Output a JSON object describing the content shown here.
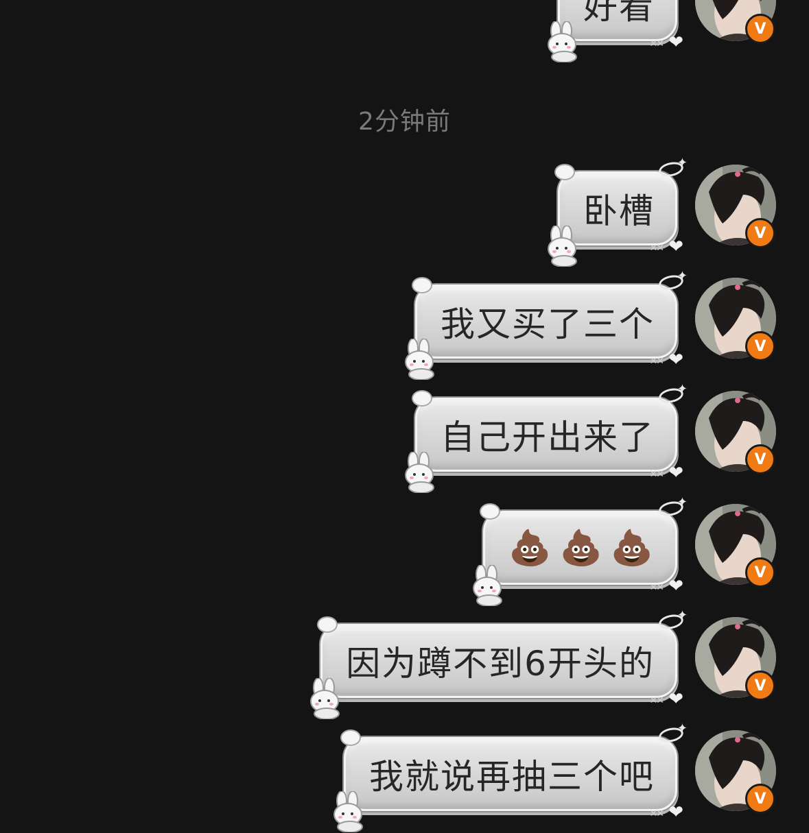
{
  "timestamp": "2分钟前",
  "messages": [
    {
      "text": "好看",
      "partial": true
    },
    {
      "text": "卧槽"
    },
    {
      "text": "我又买了三个"
    },
    {
      "text": "自己开出来了"
    },
    {
      "emoji": [
        "💩",
        "💩",
        "💩"
      ]
    },
    {
      "text": "因为蹲不到6开头的"
    },
    {
      "text": "我就说再抽三个吧"
    }
  ],
  "badge": {
    "label": "V",
    "color": "#f07a14"
  },
  "colors": {
    "background": "#141414",
    "bubble": "#d6d6d6",
    "text": "#262626",
    "timestamp": "#7a7a7a"
  }
}
